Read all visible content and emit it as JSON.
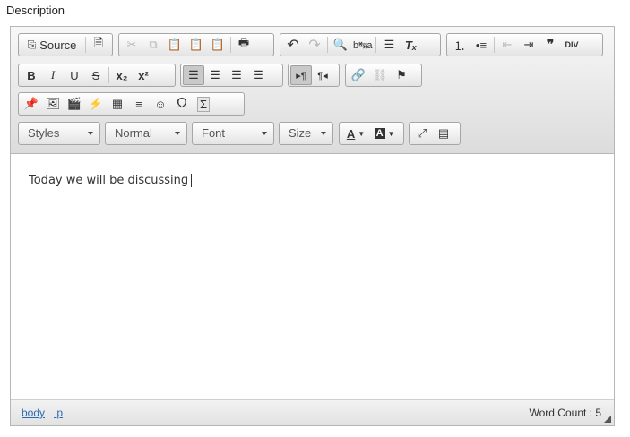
{
  "field": {
    "label": "Description"
  },
  "toolbar": {
    "source_label": "Source",
    "styles_label": "Styles",
    "format_label": "Normal",
    "font_label": "Font",
    "size_label": "Size"
  },
  "content": {
    "text": "Today we will be discussing"
  },
  "statusbar": {
    "path_items": [
      "body",
      "p"
    ],
    "word_count": "Word Count : 5"
  },
  "colors": {
    "accent_link": "#2a6bb5",
    "toolbar_bg": "#e4e4e4"
  }
}
